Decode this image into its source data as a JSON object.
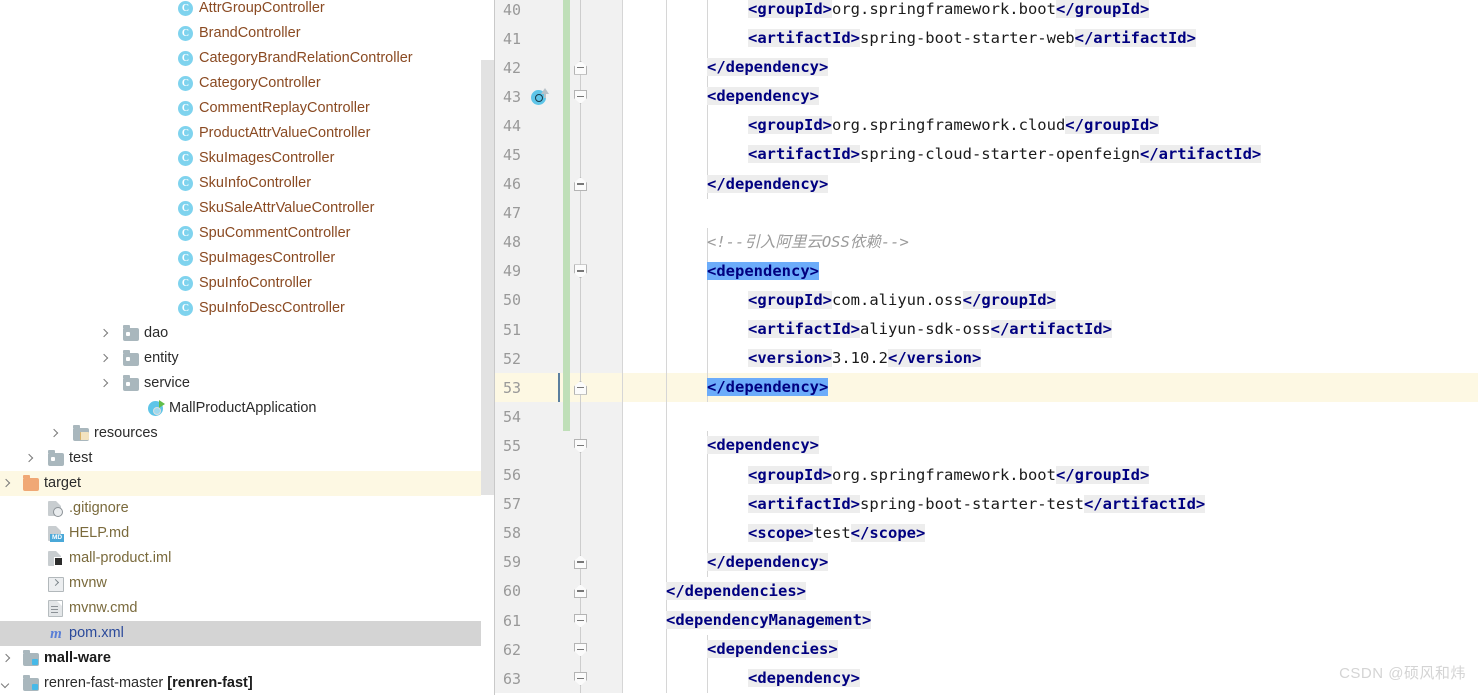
{
  "colors": {
    "tag": "#000080",
    "tag_bg": "#ededed",
    "selection": "#6cacfa",
    "caret_line": "#fdf8e3",
    "gutter_bg": "#f1f1f1",
    "change_bar": "#bfdfb8",
    "tree_selected": "#d4d4d4",
    "tree_hover": "#fdf8e3",
    "class_icon": "#7fd3ee",
    "class_label": "#8a4a22",
    "file_label": "#7a6a3c",
    "pom_label": "#2b4a9b",
    "watermark": "#d4d4d4"
  },
  "project_tree": {
    "items": [
      {
        "label": "AttrGroupController",
        "icon": "java-class-icon",
        "indent": 178,
        "arrow": "none",
        "style": "class",
        "state": "normal"
      },
      {
        "label": "BrandController",
        "icon": "java-class-icon",
        "indent": 178,
        "arrow": "none",
        "style": "class",
        "state": "normal"
      },
      {
        "label": "CategoryBrandRelationController",
        "icon": "java-class-icon",
        "indent": 178,
        "arrow": "none",
        "style": "class",
        "state": "normal"
      },
      {
        "label": "CategoryController",
        "icon": "java-class-icon",
        "indent": 178,
        "arrow": "none",
        "style": "class",
        "state": "normal"
      },
      {
        "label": "CommentReplayController",
        "icon": "java-class-icon",
        "indent": 178,
        "arrow": "none",
        "style": "class",
        "state": "normal"
      },
      {
        "label": "ProductAttrValueController",
        "icon": "java-class-icon",
        "indent": 178,
        "arrow": "none",
        "style": "class",
        "state": "normal"
      },
      {
        "label": "SkuImagesController",
        "icon": "java-class-icon",
        "indent": 178,
        "arrow": "none",
        "style": "class",
        "state": "normal"
      },
      {
        "label": "SkuInfoController",
        "icon": "java-class-icon",
        "indent": 178,
        "arrow": "none",
        "style": "class",
        "state": "normal"
      },
      {
        "label": "SkuSaleAttrValueController",
        "icon": "java-class-icon",
        "indent": 178,
        "arrow": "none",
        "style": "class",
        "state": "normal"
      },
      {
        "label": "SpuCommentController",
        "icon": "java-class-icon",
        "indent": 178,
        "arrow": "none",
        "style": "class",
        "state": "normal"
      },
      {
        "label": "SpuImagesController",
        "icon": "java-class-icon",
        "indent": 178,
        "arrow": "none",
        "style": "class",
        "state": "normal"
      },
      {
        "label": "SpuInfoController",
        "icon": "java-class-icon",
        "indent": 178,
        "arrow": "none",
        "style": "class",
        "state": "normal"
      },
      {
        "label": "SpuInfoDescController",
        "icon": "java-class-icon",
        "indent": 178,
        "arrow": "none",
        "style": "class",
        "state": "normal"
      },
      {
        "label": "dao",
        "icon": "folder-icon",
        "indent": 123,
        "arrow": "collapsed",
        "style": "plain",
        "state": "normal"
      },
      {
        "label": "entity",
        "icon": "folder-icon",
        "indent": 123,
        "arrow": "collapsed",
        "style": "plain",
        "state": "normal"
      },
      {
        "label": "service",
        "icon": "folder-icon",
        "indent": 123,
        "arrow": "collapsed",
        "style": "plain",
        "state": "normal"
      },
      {
        "label": "MallProductApplication",
        "icon": "spring-boot-icon",
        "indent": 148,
        "arrow": "none",
        "style": "plain",
        "state": "normal"
      },
      {
        "label": "resources",
        "icon": "resources-folder-icon",
        "indent": 73,
        "arrow": "collapsed",
        "style": "plain",
        "state": "normal"
      },
      {
        "label": "test",
        "icon": "folder-icon",
        "indent": 48,
        "arrow": "collapsed",
        "style": "plain",
        "state": "normal"
      },
      {
        "label": "target",
        "icon": "target-folder-icon",
        "indent": 23,
        "arrow": "collapsed",
        "style": "plain",
        "state": "hover"
      },
      {
        "label": ".gitignore",
        "icon": "gitignore-file-icon",
        "indent": 48,
        "arrow": "none",
        "style": "file",
        "state": "normal"
      },
      {
        "label": "HELP.md",
        "icon": "markdown-file-icon",
        "indent": 48,
        "arrow": "none",
        "style": "file",
        "state": "normal"
      },
      {
        "label": "mall-product.iml",
        "icon": "iml-file-icon",
        "indent": 48,
        "arrow": "none",
        "style": "file",
        "state": "normal"
      },
      {
        "label": "mvnw",
        "icon": "shell-script-icon",
        "indent": 48,
        "arrow": "none",
        "style": "file",
        "state": "normal"
      },
      {
        "label": "mvnw.cmd",
        "icon": "cmd-file-icon",
        "indent": 48,
        "arrow": "none",
        "style": "file",
        "state": "normal"
      },
      {
        "label": "pom.xml",
        "icon": "maven-file-icon",
        "indent": 48,
        "arrow": "none",
        "style": "pom",
        "state": "selected"
      },
      {
        "label": "mall-ware",
        "icon": "module-folder-icon",
        "indent": 23,
        "arrow": "collapsed",
        "style": "bold",
        "state": "normal"
      },
      {
        "label": "renren-fast-master ",
        "label2": "[renren-fast]",
        "icon": "module-folder-icon",
        "indent": 23,
        "arrow": "expanded",
        "style": "module",
        "state": "normal"
      }
    ]
  },
  "editor": {
    "lines": [
      {
        "no": "40",
        "indent": 2,
        "fold": "none",
        "change": true,
        "gicon": false,
        "tokens": [
          {
            "t": "tag",
            "v": "<groupId>"
          },
          {
            "t": "txt",
            "v": "org.springframework.boot"
          },
          {
            "t": "tag",
            "v": "</groupId>"
          }
        ]
      },
      {
        "no": "41",
        "indent": 2,
        "fold": "none",
        "change": true,
        "gicon": false,
        "tokens": [
          {
            "t": "tag",
            "v": "<artifactId>"
          },
          {
            "t": "txt",
            "v": "spring-boot-starter-web"
          },
          {
            "t": "tag",
            "v": "</artifactId>"
          }
        ]
      },
      {
        "no": "42",
        "indent": 1,
        "fold": "up",
        "change": true,
        "gicon": false,
        "tokens": [
          {
            "t": "tag",
            "v": "</dependency>"
          }
        ]
      },
      {
        "no": "43",
        "indent": 1,
        "fold": "down",
        "change": true,
        "gicon": true,
        "tokens": [
          {
            "t": "tag",
            "v": "<dependency>"
          }
        ]
      },
      {
        "no": "44",
        "indent": 2,
        "fold": "none",
        "change": true,
        "gicon": false,
        "tokens": [
          {
            "t": "tag",
            "v": "<groupId>"
          },
          {
            "t": "txt",
            "v": "org.springframework.cloud"
          },
          {
            "t": "tag",
            "v": "</groupId>"
          }
        ]
      },
      {
        "no": "45",
        "indent": 2,
        "fold": "none",
        "change": true,
        "gicon": false,
        "tokens": [
          {
            "t": "tag",
            "v": "<artifactId>"
          },
          {
            "t": "txt",
            "v": "spring-cloud-starter-openfeign"
          },
          {
            "t": "tag",
            "v": "</artifactId>"
          }
        ]
      },
      {
        "no": "46",
        "indent": 1,
        "fold": "up",
        "change": true,
        "gicon": false,
        "tokens": [
          {
            "t": "tag",
            "v": "</dependency>"
          }
        ]
      },
      {
        "no": "47",
        "indent": 0,
        "fold": "none",
        "change": true,
        "gicon": false,
        "tokens": []
      },
      {
        "no": "48",
        "indent": 1,
        "fold": "none",
        "change": true,
        "gicon": false,
        "tokens": [
          {
            "t": "cmt",
            "v": "<!--引入阿里云OSS依赖-->"
          }
        ]
      },
      {
        "no": "49",
        "indent": 1,
        "fold": "down",
        "change": true,
        "gicon": false,
        "tokens": [
          {
            "t": "tag-hl",
            "v": "<dependency>"
          }
        ]
      },
      {
        "no": "50",
        "indent": 2,
        "fold": "none",
        "change": true,
        "gicon": false,
        "tokens": [
          {
            "t": "tag",
            "v": "<groupId>"
          },
          {
            "t": "txt",
            "v": "com.aliyun.oss"
          },
          {
            "t": "tag",
            "v": "</groupId>"
          }
        ]
      },
      {
        "no": "51",
        "indent": 2,
        "fold": "none",
        "change": true,
        "gicon": false,
        "tokens": [
          {
            "t": "tag",
            "v": "<artifactId>"
          },
          {
            "t": "txt",
            "v": "aliyun-sdk-oss"
          },
          {
            "t": "tag",
            "v": "</artifactId>"
          }
        ]
      },
      {
        "no": "52",
        "indent": 2,
        "fold": "none",
        "change": true,
        "gicon": false,
        "tokens": [
          {
            "t": "tag",
            "v": "<version>"
          },
          {
            "t": "txt",
            "v": "3.10.2"
          },
          {
            "t": "tag",
            "v": "</version>"
          }
        ]
      },
      {
        "no": "53",
        "indent": 1,
        "fold": "up",
        "change": true,
        "gicon": false,
        "caret": true,
        "tokens": [
          {
            "t": "tag-hl",
            "v": "</dependency>"
          }
        ]
      },
      {
        "no": "54",
        "indent": 0,
        "fold": "none",
        "change": true,
        "gicon": false,
        "tokens": []
      },
      {
        "no": "55",
        "indent": 1,
        "fold": "down",
        "change": false,
        "gicon": false,
        "tokens": [
          {
            "t": "tag",
            "v": "<dependency>"
          }
        ]
      },
      {
        "no": "56",
        "indent": 2,
        "fold": "none",
        "change": false,
        "gicon": false,
        "tokens": [
          {
            "t": "tag",
            "v": "<groupId>"
          },
          {
            "t": "txt",
            "v": "org.springframework.boot"
          },
          {
            "t": "tag",
            "v": "</groupId>"
          }
        ]
      },
      {
        "no": "57",
        "indent": 2,
        "fold": "none",
        "change": false,
        "gicon": false,
        "tokens": [
          {
            "t": "tag",
            "v": "<artifactId>"
          },
          {
            "t": "txt",
            "v": "spring-boot-starter-test"
          },
          {
            "t": "tag",
            "v": "</artifactId>"
          }
        ]
      },
      {
        "no": "58",
        "indent": 2,
        "fold": "none",
        "change": false,
        "gicon": false,
        "tokens": [
          {
            "t": "tag",
            "v": "<scope>"
          },
          {
            "t": "txt",
            "v": "test"
          },
          {
            "t": "tag",
            "v": "</scope>"
          }
        ]
      },
      {
        "no": "59",
        "indent": 1,
        "fold": "up",
        "change": false,
        "gicon": false,
        "tokens": [
          {
            "t": "tag",
            "v": "</dependency>"
          }
        ]
      },
      {
        "no": "60",
        "indent": 0,
        "fold": "up",
        "change": false,
        "gicon": false,
        "tokens": [
          {
            "t": "tag",
            "v": "</dependencies>"
          }
        ]
      },
      {
        "no": "61",
        "indent": 0,
        "fold": "down",
        "change": false,
        "gicon": false,
        "tokens": [
          {
            "t": "tag",
            "v": "<dependencyManagement>"
          }
        ]
      },
      {
        "no": "62",
        "indent": 1,
        "fold": "down",
        "change": false,
        "gicon": false,
        "tokens": [
          {
            "t": "tag",
            "v": "<dependencies>"
          }
        ]
      },
      {
        "no": "63",
        "indent": 2,
        "fold": "down",
        "change": false,
        "gicon": false,
        "tokens": [
          {
            "t": "tag",
            "v": "<dependency>"
          }
        ]
      }
    ]
  },
  "watermark": {
    "text": "CSDN @硕风和炜"
  }
}
